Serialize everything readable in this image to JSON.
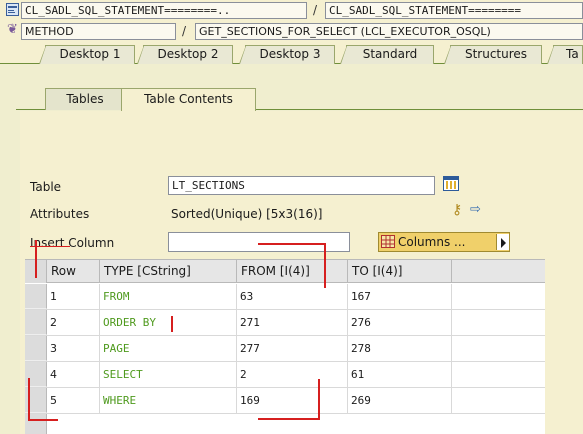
{
  "header": {
    "row1_left": "CL_SADL_SQL_STATEMENT========..",
    "row1_right": "CL_SADL_SQL_STATEMENT========",
    "row2_left": "METHOD",
    "row2_right": "GET_SECTIONS_FOR_SELECT (LCL_EXECUTOR_OSQL)",
    "separator": "/"
  },
  "tabs": [
    "Desktop 1",
    "Desktop 2",
    "Desktop 3",
    "Standard",
    "Structures",
    "Ta"
  ],
  "inner_tabs": [
    "Tables",
    "Table Contents"
  ],
  "form": {
    "table_label": "Table",
    "table_value": "LT_SECTIONS",
    "attributes_label": "Attributes",
    "attributes_value": "Sorted(Unique) [5x3(16)]",
    "insert_column_label": "Insert Column",
    "insert_column_value": "",
    "columns_button": "Columns ..."
  },
  "grid": {
    "headers": [
      "Row",
      "TYPE [CString]",
      "FROM [I(4)]",
      "TO [I(4)]"
    ],
    "rows": [
      {
        "row": "1",
        "type": "FROM",
        "from": "63",
        "to": "167"
      },
      {
        "row": "2",
        "type": "ORDER BY",
        "from": "271",
        "to": "276"
      },
      {
        "row": "3",
        "type": "PAGE",
        "from": "277",
        "to": "278"
      },
      {
        "row": "4",
        "type": "SELECT",
        "from": "2",
        "to": "61"
      },
      {
        "row": "5",
        "type": "WHERE",
        "from": "169",
        "to": "269"
      }
    ]
  },
  "colors": {
    "background": "#f5f0d0",
    "green_text": "#4f9a1e",
    "annotation_red": "#d61f1f"
  }
}
